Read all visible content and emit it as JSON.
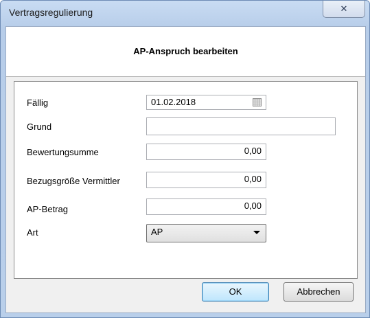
{
  "window": {
    "title": "Vertragsregulierung",
    "close_glyph": "✕"
  },
  "header": {
    "title": "AP-Anspruch bearbeiten"
  },
  "form": {
    "faellig": {
      "label": "Fällig",
      "value": "01.02.2018"
    },
    "grund": {
      "label": "Grund",
      "value": ""
    },
    "bewertungsumme": {
      "label": "Bewertungsumme",
      "value": "0,00"
    },
    "bezugsgroesse": {
      "label": "Bezugsgröße Vermittler",
      "value": "0,00"
    },
    "ap_betrag": {
      "label": "AP-Betrag",
      "value": "0,00"
    },
    "art": {
      "label": "Art",
      "value": "AP"
    }
  },
  "buttons": {
    "ok": "OK",
    "cancel": "Abbrechen"
  },
  "icons": {
    "close": "close-icon",
    "calendar": "calendar-icon",
    "dropdown": "chevron-down-icon"
  }
}
